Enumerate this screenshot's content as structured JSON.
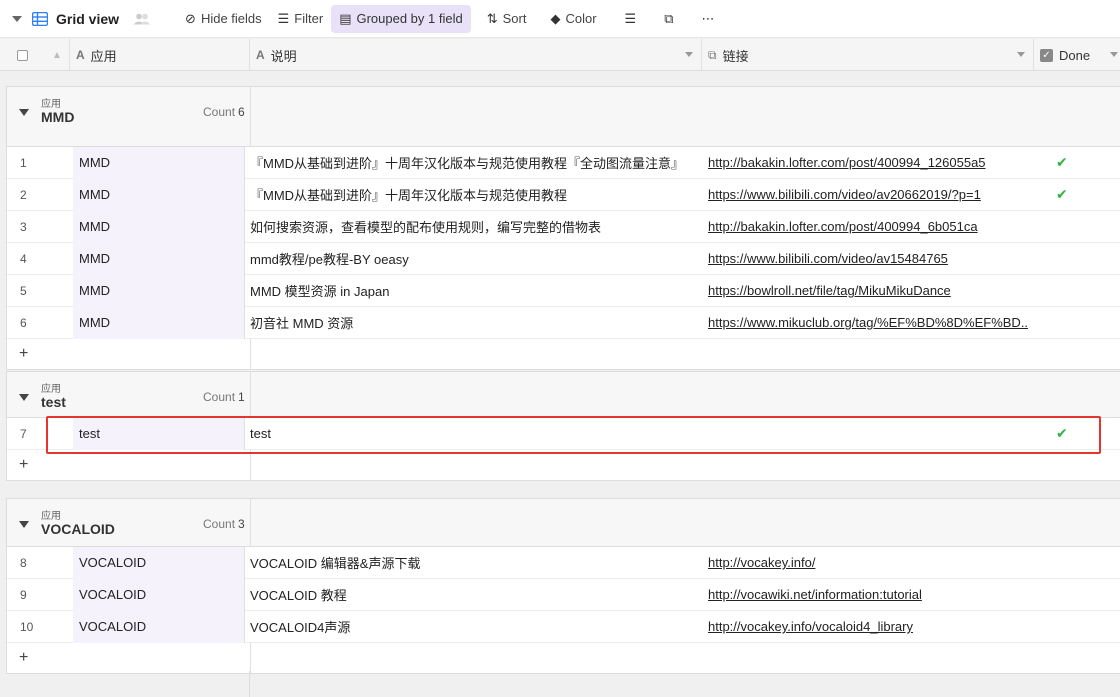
{
  "toolbar": {
    "view_name": "Grid view",
    "hide_fields": "Hide fields",
    "filter": "Filter",
    "grouped": "Grouped by 1 field",
    "sort": "Sort",
    "color": "Color"
  },
  "columns": {
    "app": "应用",
    "desc": "说明",
    "link": "链接",
    "done": "Done"
  },
  "groups": [
    {
      "field": "应用",
      "value": "MMD",
      "count_label": "Count",
      "count": "6",
      "rows": [
        {
          "num": "1",
          "app": "MMD",
          "desc": "『MMD从基础到进阶』十周年汉化版本与规范使用教程『全动图流量注意』",
          "link": "http://bakakin.lofter.com/post/400994_126055a5",
          "done": "✔"
        },
        {
          "num": "2",
          "app": "MMD",
          "desc": "『MMD从基础到进阶』十周年汉化版本与规范使用教程",
          "link": "https://www.bilibili.com/video/av20662019/?p=1",
          "done": "✔"
        },
        {
          "num": "3",
          "app": "MMD",
          "desc": "如何搜索资源，查看模型的配布使用规则，编写完整的借物表",
          "link": "http://bakakin.lofter.com/post/400994_6b051ca",
          "done": ""
        },
        {
          "num": "4",
          "app": "MMD",
          "desc": "mmd教程/pe教程-BY oeasy",
          "link": "https://www.bilibili.com/video/av15484765",
          "done": ""
        },
        {
          "num": "5",
          "app": "MMD",
          "desc": "MMD 模型资源 in Japan",
          "link": "https://bowlroll.net/file/tag/MikuMikuDance",
          "done": ""
        },
        {
          "num": "6",
          "app": "MMD",
          "desc": "初音社 MMD 资源",
          "link": "https://www.mikuclub.org/tag/%EF%BD%8D%EF%BD...",
          "done": ""
        }
      ]
    },
    {
      "field": "应用",
      "value": "test",
      "count_label": "Count",
      "count": "1",
      "rows": [
        {
          "num": "7",
          "app": "test",
          "desc": "test",
          "link": "",
          "done": "✔"
        }
      ]
    },
    {
      "field": "应用",
      "value": "VOCALOID",
      "count_label": "Count",
      "count": "3",
      "rows": [
        {
          "num": "8",
          "app": "VOCALOID",
          "desc": "VOCALOID 编辑器&声源下载",
          "link": "http://vocakey.info/",
          "done": ""
        },
        {
          "num": "9",
          "app": "VOCALOID",
          "desc": "VOCALOID 教程",
          "link": "http://vocawiki.net/information:tutorial",
          "done": ""
        },
        {
          "num": "10",
          "app": "VOCALOID",
          "desc": "VOCALOID4声源",
          "link": "http://vocakey.info/vocaloid4_library",
          "done": ""
        }
      ]
    }
  ],
  "add_row_label": "+"
}
